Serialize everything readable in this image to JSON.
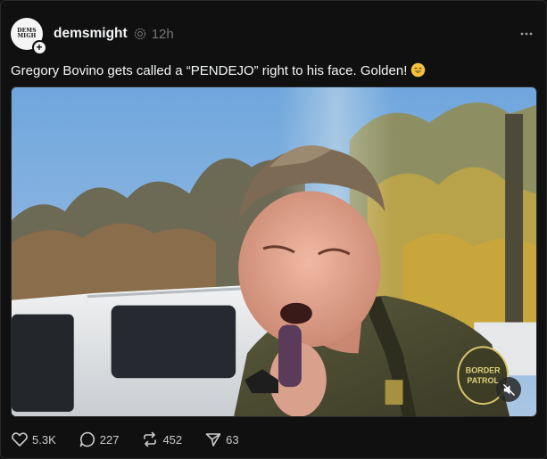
{
  "post": {
    "avatar_text": "DEMS\nMIGH",
    "username": "demsmight",
    "timestamp": "12h",
    "caption": "Gregory Bovino gets called a “PENDEJO” right to his face. Golden!",
    "caption_emoji": "grinning-face-with-sweat",
    "media_badge_text": "BORDER\nPATROL",
    "media_muted": true
  },
  "actions": {
    "likes": "5.3K",
    "replies": "227",
    "reposts": "452",
    "shares": "63"
  },
  "colors": {
    "background": "#101010",
    "text_primary": "#f3f5f7",
    "text_secondary": "#777777",
    "counts": "#cccccc"
  }
}
